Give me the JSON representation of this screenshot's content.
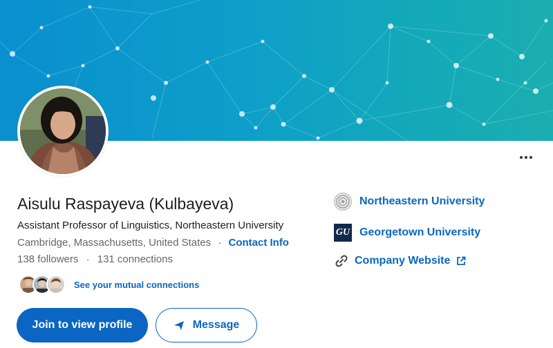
{
  "profile": {
    "name": "Aisulu Raspayeva (Kulbayeva)",
    "headline": "Assistant Professor of Linguistics, Northeastern University",
    "location": "Cambridge, Massachusetts, United States",
    "separator": "·",
    "contact_label": "Contact Info",
    "followers": "138 followers",
    "connections": "131 connections",
    "mutual_label": "See your mutual connections"
  },
  "actions": {
    "join_label": "Join to view profile",
    "message_label": "Message"
  },
  "affiliations": [
    {
      "label": "Northeastern University",
      "icon": "northeastern-seal-icon"
    },
    {
      "label": "Georgetown University",
      "icon": "georgetown-logo-icon",
      "logo_text": "GU"
    },
    {
      "label": "Company Website",
      "icon": "link-icon",
      "external_icon": "external-link-icon"
    }
  ],
  "colors": {
    "accent": "#0a66c2",
    "banner_start": "#0a8fcf",
    "banner_end": "#1aaeb0"
  }
}
